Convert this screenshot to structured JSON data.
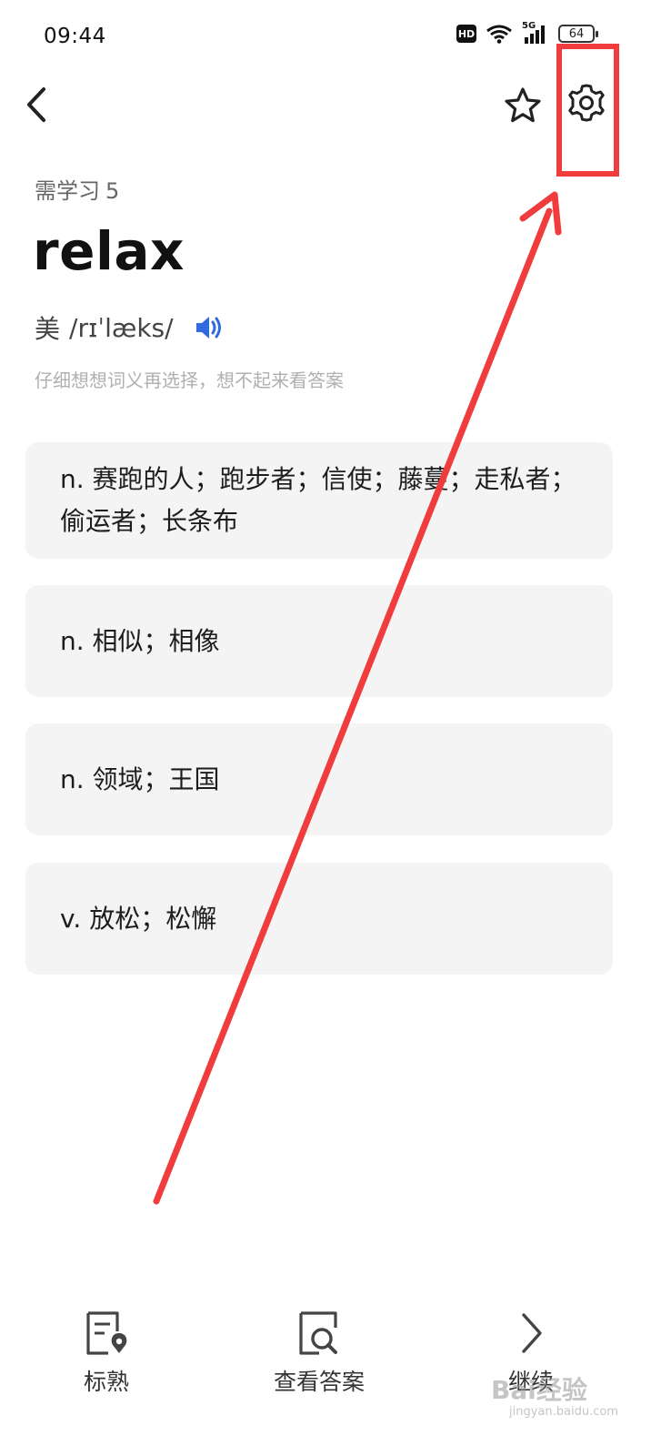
{
  "status_bar": {
    "time": "09:44",
    "network": "5G",
    "hd": "HD",
    "battery": "64"
  },
  "header": {
    "back_icon": "chevron-left-icon",
    "favorite_icon": "star-icon",
    "settings_icon": "gear-icon"
  },
  "study": {
    "label": "需学习",
    "count": "5"
  },
  "word": {
    "text": "relax",
    "accent": "美",
    "phonetic": "/rɪˈlæks/",
    "speaker_icon": "speaker-icon",
    "speaker_color": "#2f6bdc"
  },
  "hint": "仔细想想词义再选择，想不起来看答案",
  "options": [
    {
      "text": "n. 赛跑的人；跑步者；信使；藤蔓；走私者；偷运者；长条布"
    },
    {
      "text": "n. 相似；相像"
    },
    {
      "text": "n. 领域；王国"
    },
    {
      "text": "v. 放松；松懈"
    }
  ],
  "bottom_bar": {
    "mark_known": {
      "label": "标熟",
      "icon": "mark-known-icon"
    },
    "view_answer": {
      "label": "查看答案",
      "icon": "view-answer-icon"
    },
    "continue": {
      "label": "继续",
      "icon": "chevron-right-icon"
    }
  },
  "annotation_color": "#f03c3c",
  "watermark": {
    "text": "Bai经验",
    "sub": "jingyan.baidu.com"
  }
}
